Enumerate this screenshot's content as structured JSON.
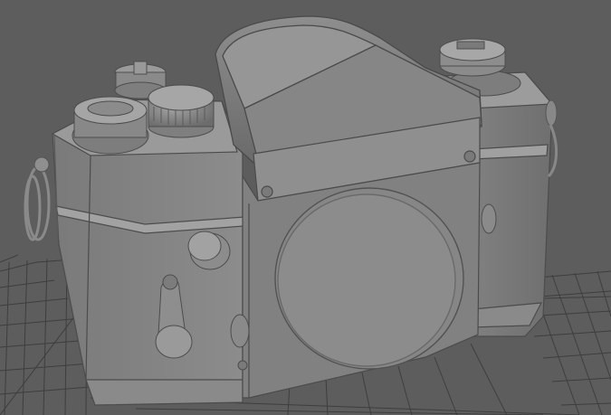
{
  "scene": {
    "subject": "camera-body-model",
    "colors": {
      "background": "#5d5d5d",
      "grid": "#3c3c3c",
      "model_light": "#9a9a9a",
      "model_mid": "#7f7f7f",
      "model_dark": "#5f5f5f",
      "model_edge": "#4a4a4a"
    }
  }
}
